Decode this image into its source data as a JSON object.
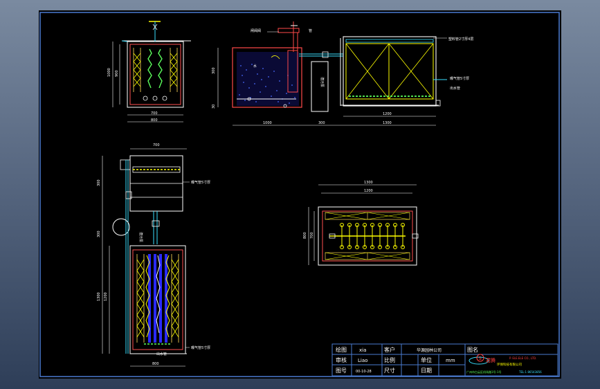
{
  "drawing": {
    "dims": {
      "side_height_total": "1000",
      "side_height_inner": "900",
      "side_width_inner": "700",
      "side_width_outer": "800",
      "front_height": "300",
      "front_height_small": "30",
      "front_tank_width": "1000",
      "front_gap": "300",
      "front_right_width_inner": "1200",
      "front_right_width_outer": "1300",
      "plan_top_width": "700",
      "plan_left_300": "300",
      "plan_left_300b": "300",
      "plan_left_1200": "1200",
      "plan_left_1300": "1300",
      "plan_bottom_width": "800",
      "plan_right_1300": "1300",
      "plan_right_1200": "1200",
      "plan_right_h700": "700",
      "plan_right_h800": "800"
    },
    "labels": {
      "valve": "闸阀阀",
      "pipe_tag": "管",
      "front_tag_top_right": "塑料管2寸厚4层",
      "front_tag_right1": "曝气管5寸厚",
      "front_tag_right2": "出水管",
      "front_water": "水",
      "front_pump_text": "潜污泵",
      "plan_tag1": "曝气管5寸厚",
      "plan_tag2": "曝气管5寸厚",
      "plan_tag3": "出水管"
    }
  },
  "titleblock": {
    "drawn_label": "绘图",
    "drawn_value": "xia",
    "client_label": "客户",
    "client_value": "华源园林公司",
    "drawing_name_label": "图名",
    "checked_label": "审核",
    "checked_value": "Liao",
    "scale_label": "比例",
    "unit_label": "单位",
    "unit_value": "mm",
    "drawing_no_label": "图号",
    "drawing_no_value": "00-10-28",
    "size_label": "尺寸",
    "date_label": "日期",
    "company_en": "P. ELE.ELE CO., LTD.",
    "company_cn": "环保科技有限公司",
    "company_addr": "广州市白云区机场路1号-1号",
    "company_tel": "TEL:1 86543856",
    "logo_text": "S",
    "logo_word": "君腾"
  }
}
